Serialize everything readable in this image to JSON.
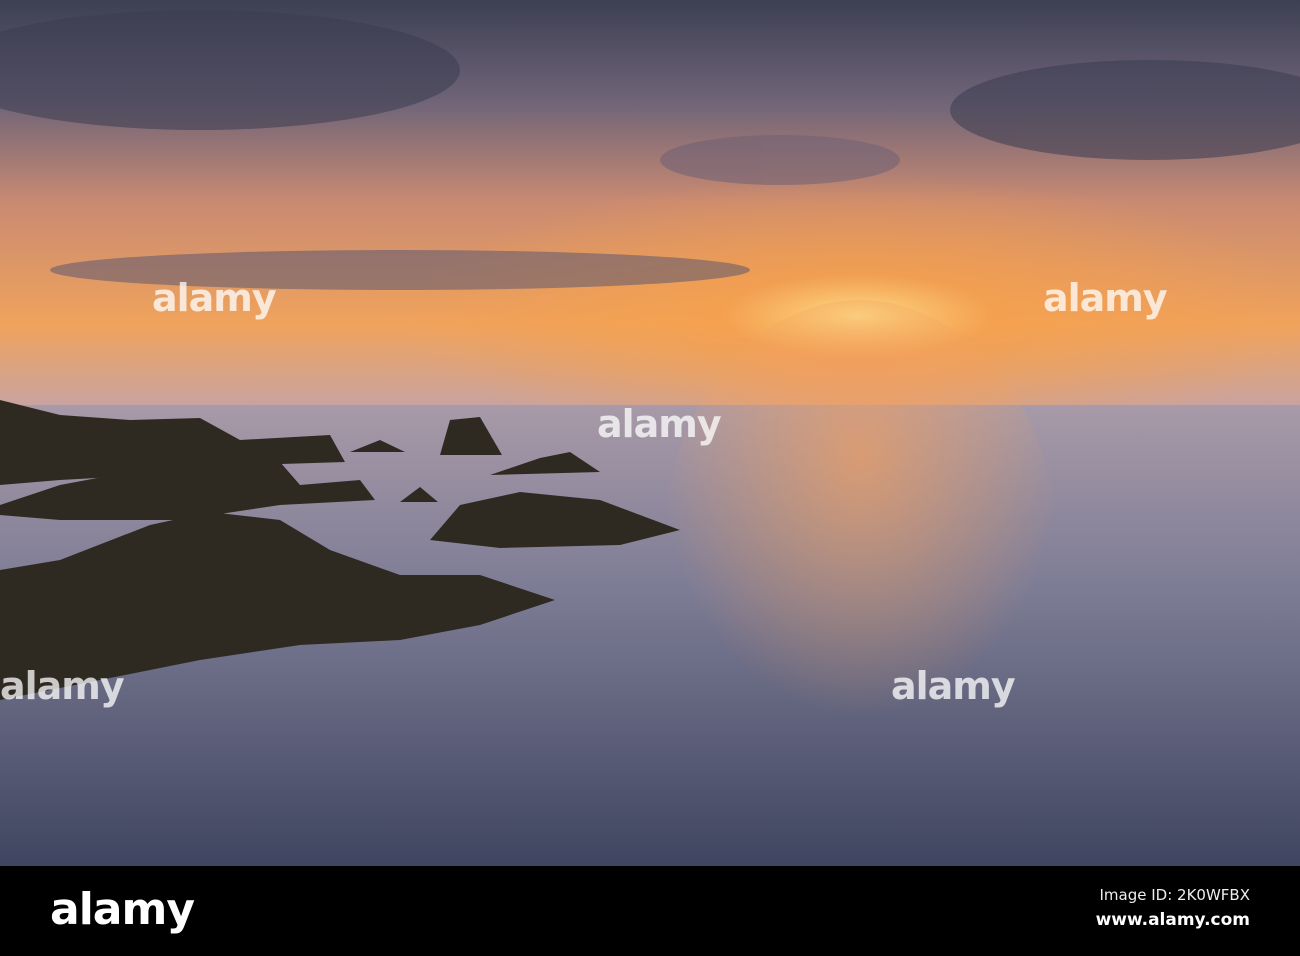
{
  "image": {
    "subject": "long exposure seascape at sunset with rocks",
    "colors": {
      "sky_top": "#4a4a5e",
      "glow": "#f5a24a",
      "sea": "#6c6f88",
      "rock": "#2e2a22"
    }
  },
  "watermark": {
    "logo": "alamy",
    "mark": "a"
  },
  "footer": {
    "logo": "alamy",
    "image_id": "Image ID: 2K0WFBX",
    "url": "www.alamy.com"
  }
}
